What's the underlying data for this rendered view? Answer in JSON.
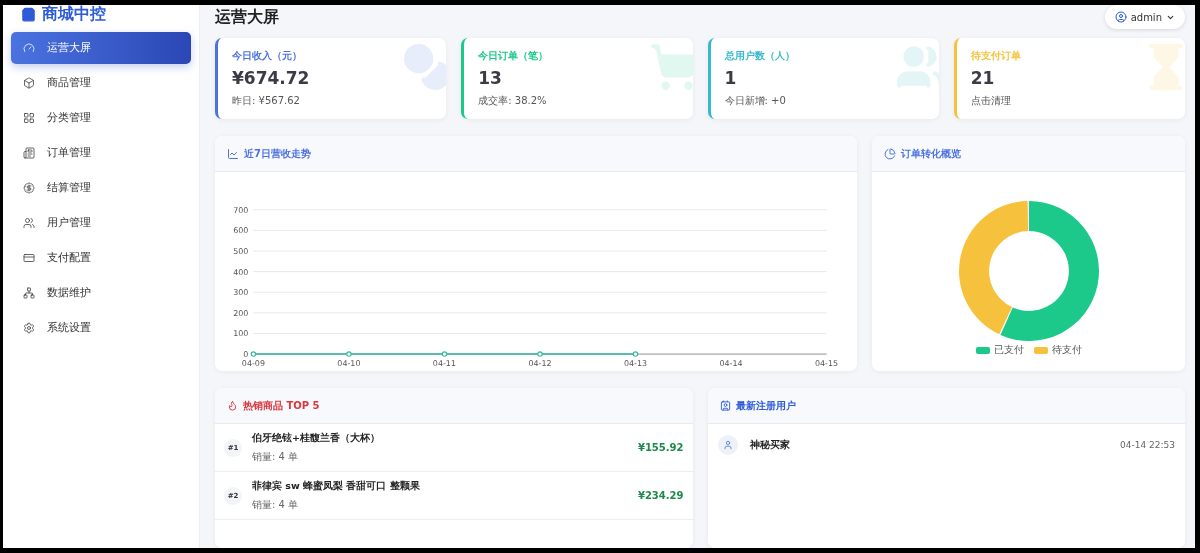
{
  "sidebar": {
    "brand": "商城中控",
    "items": [
      {
        "label": "运营大屏",
        "selected": true
      },
      {
        "label": "商品管理",
        "selected": false
      },
      {
        "label": "分类管理",
        "selected": false
      },
      {
        "label": "订单管理",
        "selected": false
      },
      {
        "label": "结算管理",
        "selected": false
      },
      {
        "label": "用户管理",
        "selected": false
      },
      {
        "label": "支付配置",
        "selected": false
      },
      {
        "label": "数据维护",
        "selected": false
      },
      {
        "label": "系统设置",
        "selected": false
      }
    ]
  },
  "header": {
    "title": "运营大屏",
    "user": "admin"
  },
  "stat_cards": [
    {
      "label": "今日收入（元）",
      "value": "¥674.72",
      "sub": "昨日: ¥567.62",
      "color": "#4e73df"
    },
    {
      "label": "今日订单（笔）",
      "value": "13",
      "sub": "成交率: 38.2%",
      "color": "#1cc88a"
    },
    {
      "label": "总用户数（人）",
      "value": "1",
      "sub": "今日新增: +0",
      "color": "#36b9cc"
    },
    {
      "label": "待支付订单",
      "value": "21",
      "sub": "点击清理",
      "color": "#f6c23e"
    }
  ],
  "revenue_panel": {
    "title": "近7日营收走势",
    "chart_data": {
      "type": "line",
      "categories": [
        "04-09",
        "04-10",
        "04-11",
        "04-12",
        "04-13",
        "04-14",
        "04-15"
      ],
      "series": [
        {
          "color": "#36b9a0",
          "marker": true,
          "values": [
            0,
            0,
            0,
            0,
            0,
            null,
            null
          ]
        }
      ],
      "grid": true,
      "ylim": [
        0,
        700
      ],
      "yticks": [
        0,
        100,
        200,
        300,
        400,
        500,
        600,
        700
      ]
    }
  },
  "order_panel": {
    "title": "订单转化概览",
    "chart_data": {
      "type": "donut",
      "categories": [
        "已支付",
        "待支付"
      ],
      "series": [
        {
          "values": [
            57,
            43
          ]
        }
      ],
      "colors": [
        "#1cc88a",
        "#f6c23e"
      ]
    }
  },
  "hot_products": {
    "title": "热销商品 TOP 5",
    "rows": [
      {
        "rank": "#1",
        "name": "伯牙绝铉+桂馥兰香（大杯）",
        "sales": "销量: 4 单",
        "amount": "¥155.92"
      },
      {
        "rank": "#2",
        "name": "菲律宾 sw 蜂蜜凤梨 香甜可口 整颗果",
        "sales": "销量: 4 单",
        "amount": "¥234.29"
      }
    ]
  },
  "new_users": {
    "title": "最新注册用户",
    "rows": [
      {
        "name": "神秘买家",
        "time": "04-14 22:53"
      }
    ]
  }
}
